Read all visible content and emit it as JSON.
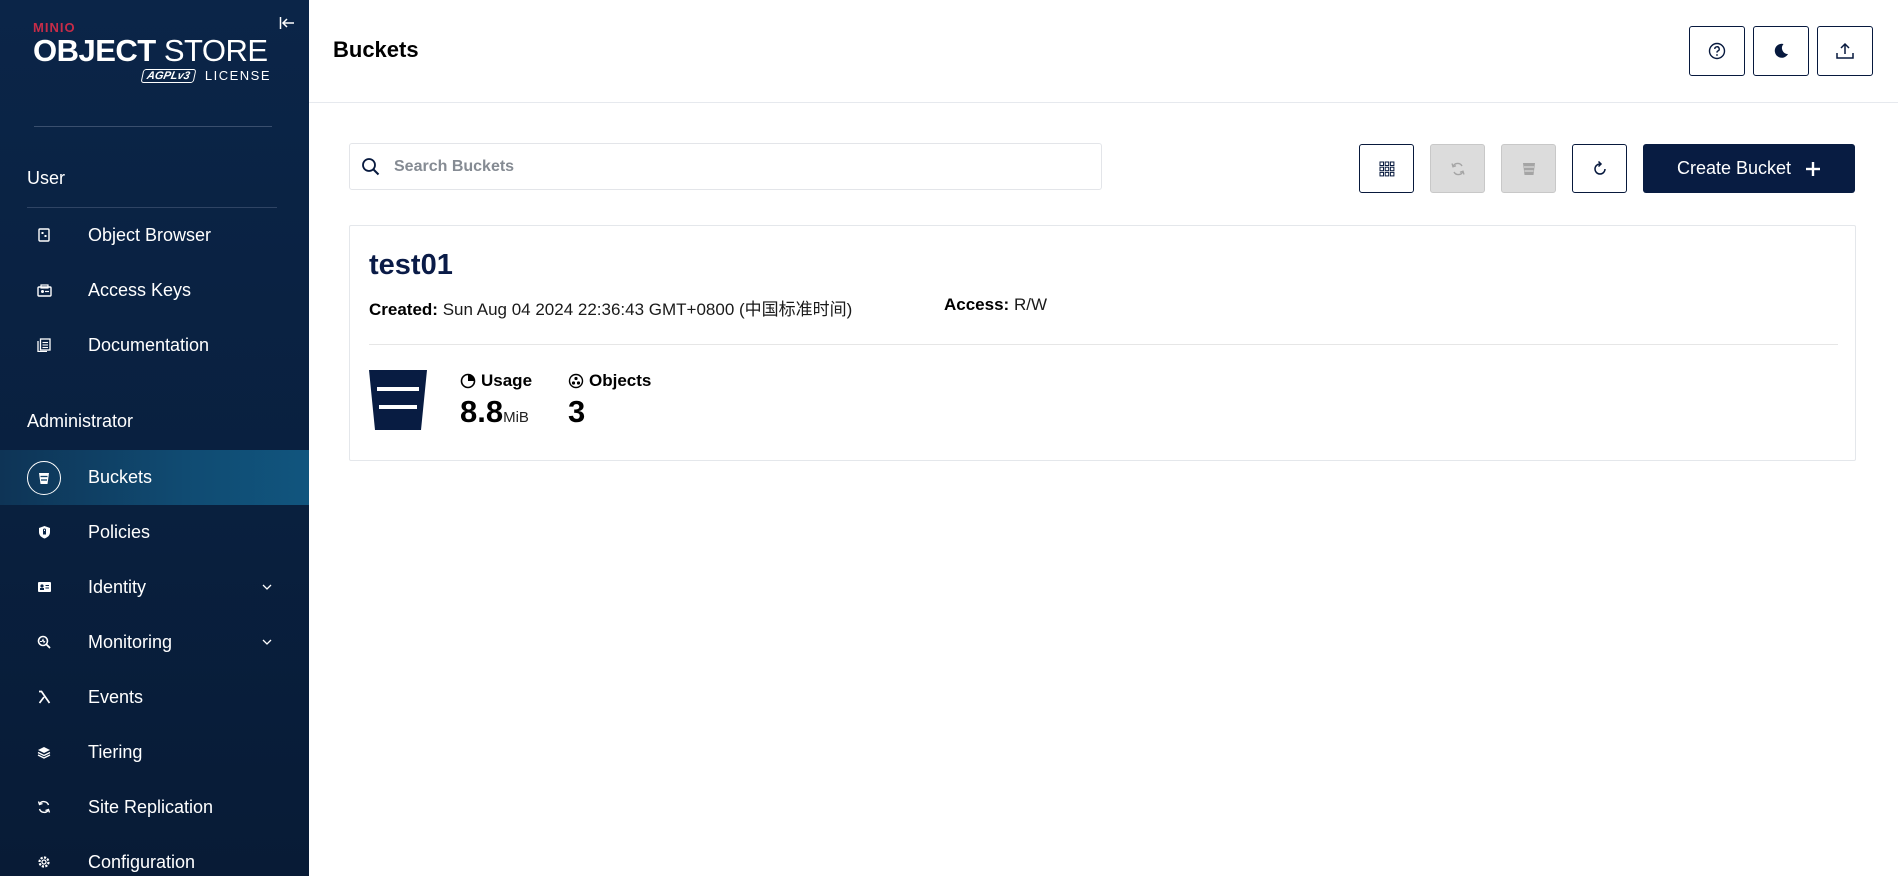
{
  "brand": {
    "minio": "MINIO",
    "object": "OBJECT",
    "store": "STORE",
    "agpl": "AGPLv3",
    "license": "LICENSE"
  },
  "sidebar": {
    "user_section": "User",
    "user_items": [
      {
        "label": "Object Browser",
        "icon": "object-browser-icon"
      },
      {
        "label": "Access Keys",
        "icon": "access-keys-icon"
      },
      {
        "label": "Documentation",
        "icon": "documentation-icon"
      }
    ],
    "admin_section": "Administrator",
    "admin_items": [
      {
        "label": "Buckets",
        "icon": "bucket-icon",
        "active": true
      },
      {
        "label": "Policies",
        "icon": "policy-shield-icon"
      },
      {
        "label": "Identity",
        "icon": "identity-card-icon",
        "expandable": true
      },
      {
        "label": "Monitoring",
        "icon": "monitoring-icon",
        "expandable": true
      },
      {
        "label": "Events",
        "icon": "lambda-icon"
      },
      {
        "label": "Tiering",
        "icon": "tiering-layers-icon"
      },
      {
        "label": "Site Replication",
        "icon": "site-replication-icon"
      },
      {
        "label": "Configuration",
        "icon": "gear-icon"
      }
    ]
  },
  "header": {
    "title": "Buckets"
  },
  "toolbar": {
    "search_placeholder": "Search Buckets",
    "search_value": "",
    "create_label": "Create Bucket"
  },
  "buckets": [
    {
      "name": "test01",
      "created_label": "Created:",
      "created_value": "Sun Aug 04 2024 22:36:43 GMT+0800 (中国标准时间)",
      "access_label": "Access:",
      "access_value": "R/W",
      "usage_label": "Usage",
      "usage_value": "8.8",
      "usage_unit": "MiB",
      "objects_label": "Objects",
      "objects_value": "3"
    }
  ],
  "colors": {
    "sidebar_bg": "#0b2548",
    "accent": "#081c42",
    "active_item": "#104b72",
    "brand_red": "#c72c48"
  }
}
